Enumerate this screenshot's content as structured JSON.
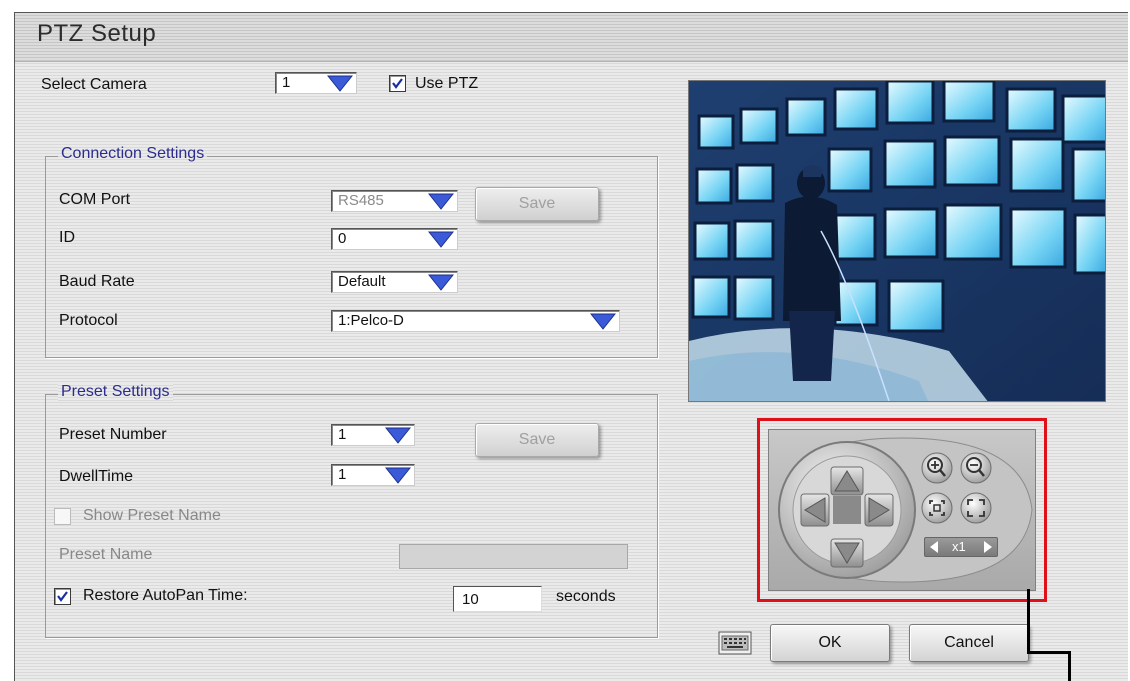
{
  "window": {
    "title": "PTZ Setup"
  },
  "camera": {
    "label": "Select Camera",
    "value": "1",
    "use_ptz_label": "Use PTZ",
    "use_ptz_checked": true
  },
  "connection": {
    "legend": "Connection Settings",
    "com_port_label": "COM Port",
    "com_port_value": "RS485",
    "save_label": "Save",
    "id_label": "ID",
    "id_value": "0",
    "baud_label": "Baud Rate",
    "baud_value": "Default",
    "protocol_label": "Protocol",
    "protocol_value": "1:Pelco-D"
  },
  "preset": {
    "legend": "Preset Settings",
    "number_label": "Preset Number",
    "number_value": "1",
    "save_label": "Save",
    "dwell_label": "DwellTime",
    "dwell_value": "1",
    "show_name_label": "Show Preset Name",
    "name_label": "Preset Name",
    "restore_label": "Restore AutoPan Time:",
    "restore_checked": true,
    "restore_value": "10",
    "seconds_label": "seconds"
  },
  "ptz_control": {
    "zoom_text": "x1"
  },
  "footer": {
    "ok_label": "OK",
    "cancel_label": "Cancel"
  },
  "colors": {
    "highlight": "#e0101a",
    "legend_text": "#2c2c8e",
    "dropdown_arrow": "#3a5ad8"
  },
  "icons": [
    "dropdown-arrow-icon",
    "checkmark-icon",
    "zoom-in-icon",
    "zoom-out-icon",
    "focus-near-icon",
    "focus-far-icon",
    "arrow-up-icon",
    "arrow-down-icon",
    "arrow-left-icon",
    "arrow-right-icon",
    "keyboard-icon"
  ]
}
